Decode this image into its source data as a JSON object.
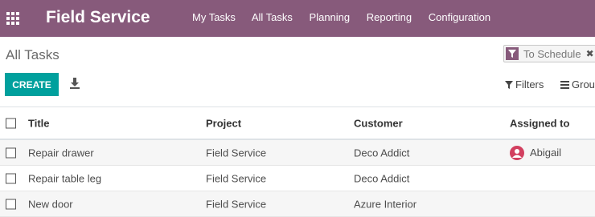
{
  "navbar": {
    "brand": "Field Service",
    "menu": [
      "My Tasks",
      "All Tasks",
      "Planning",
      "Reporting",
      "Configuration"
    ]
  },
  "control_panel": {
    "title": "All Tasks",
    "facet": "To Schedule",
    "create_label": "CREATE",
    "filters_label": "Filters",
    "groupby_label": "Grou"
  },
  "table": {
    "headers": [
      "Title",
      "Project",
      "Customer",
      "Assigned to"
    ],
    "rows": [
      {
        "title": "Repair drawer",
        "project": "Field Service",
        "customer": "Deco Addict",
        "assigned": "Abigail"
      },
      {
        "title": "Repair table leg",
        "project": "Field Service",
        "customer": "Deco Addict",
        "assigned": ""
      },
      {
        "title": "New door",
        "project": "Field Service",
        "customer": "Azure Interior",
        "assigned": ""
      }
    ]
  },
  "colors": {
    "brand": "#875a7b",
    "primary": "#00a09d",
    "avatar": "#d23f5f"
  }
}
